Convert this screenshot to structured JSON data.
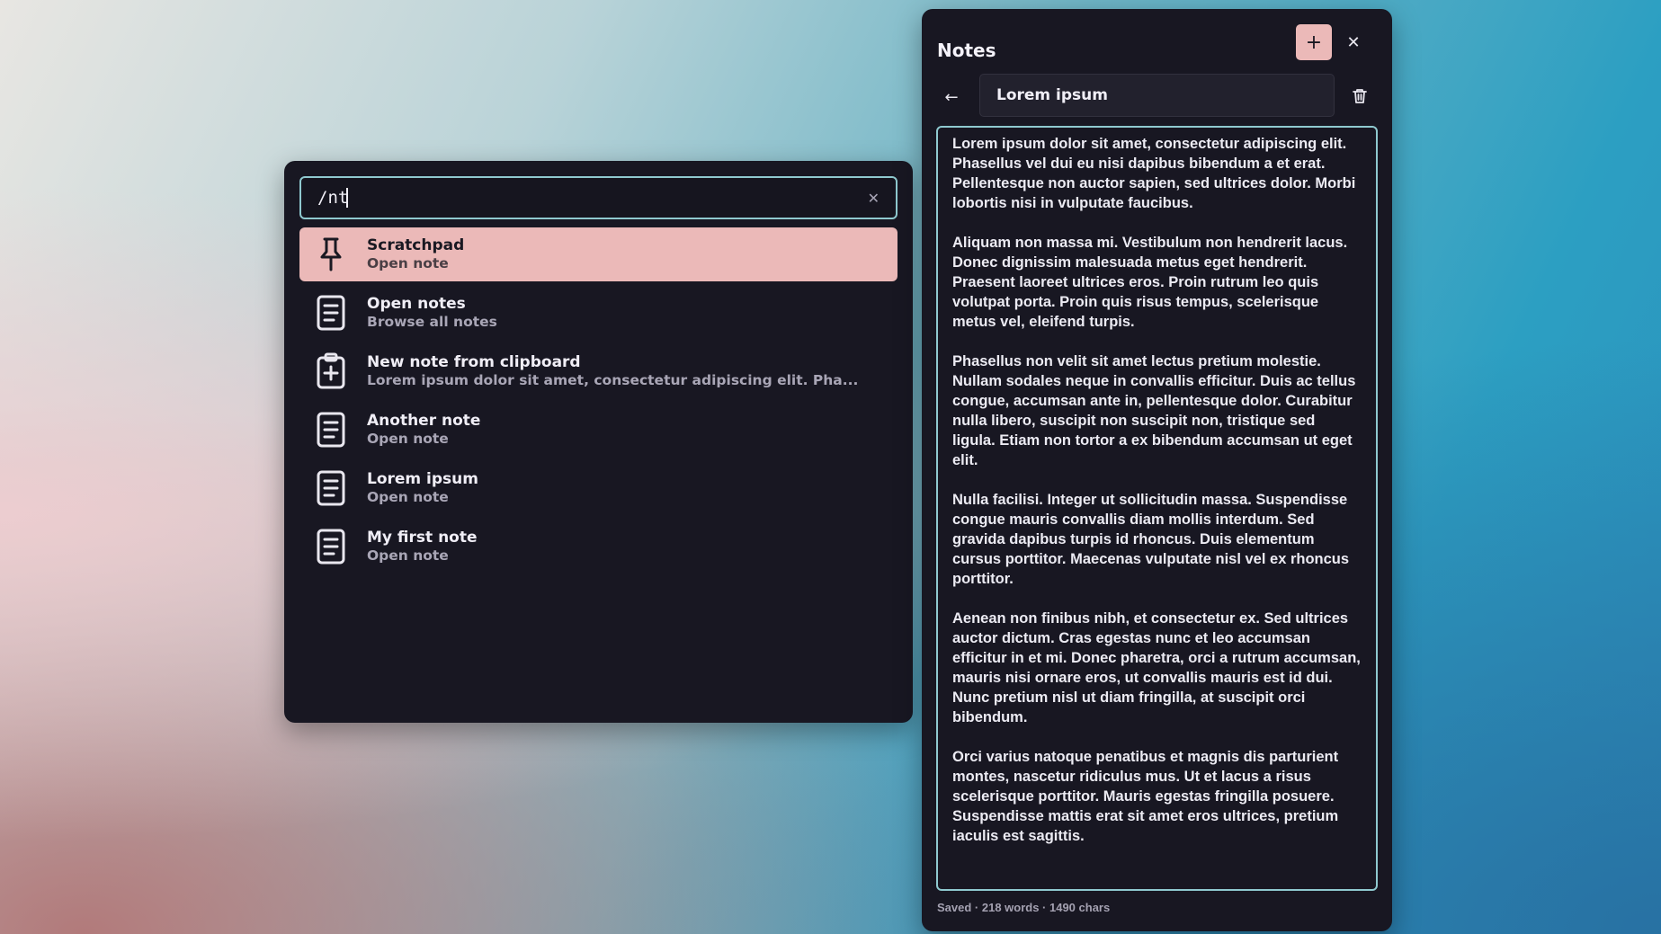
{
  "launcher": {
    "query": "/nt",
    "results": [
      {
        "icon": "pin-icon",
        "title": "Scratchpad",
        "subtitle": "Open note"
      },
      {
        "icon": "note-icon",
        "title": "Open notes",
        "subtitle": "Browse all notes"
      },
      {
        "icon": "clipboard-plus-icon",
        "title": "New note from clipboard",
        "subtitle": "Lorem ipsum dolor sit amet, consectetur adipiscing elit. Pha..."
      },
      {
        "icon": "note-icon",
        "title": "Another note",
        "subtitle": "Open note"
      },
      {
        "icon": "note-icon",
        "title": "Lorem ipsum",
        "subtitle": "Open note"
      },
      {
        "icon": "note-icon",
        "title": "My first note",
        "subtitle": "Open note"
      }
    ]
  },
  "notes": {
    "title": "Notes",
    "note_title": "Lorem ipsum",
    "paragraphs": [
      "Lorem ipsum dolor sit amet, consectetur adipiscing elit. Phasellus vel dui eu nisi dapibus bibendum a et erat. Pellentesque non auctor sapien, sed ultrices dolor. Morbi lobortis nisi in vulputate faucibus.",
      "Aliquam non massa mi. Vestibulum non hendrerit lacus. Donec dignissim malesuada metus eget hendrerit. Praesent laoreet ultrices eros. Proin rutrum leo quis volutpat porta. Proin quis risus tempus, scelerisque metus vel, eleifend turpis.",
      "Phasellus non velit sit amet lectus pretium molestie. Nullam sodales neque in convallis efficitur. Duis ac tellus congue, accumsan ante in, pellentesque dolor. Curabitur nulla libero, suscipit non suscipit non, tristique sed ligula. Etiam non tortor a ex bibendum accumsan ut eget elit.",
      "Nulla facilisi. Integer ut sollicitudin massa. Suspendisse congue mauris convallis diam mollis interdum. Sed gravida dapibus turpis id rhoncus. Duis elementum cursus porttitor. Maecenas vulputate nisl vel ex rhoncus porttitor.",
      "Aenean non finibus nibh, et consectetur ex. Sed ultrices auctor dictum. Cras egestas nunc et leo accumsan efficitur in et mi. Donec pharetra, orci a rutrum accumsan, mauris nisi ornare eros, ut convallis mauris est id dui. Nunc pretium nisl ut diam fringilla, at suscipit orci bibendum.",
      "Orci varius natoque penatibus et magnis dis parturient montes, nascetur ridiculus mus. Ut et lacus a risus scelerisque porttitor. Mauris egestas fringilla posuere. Suspendisse mattis erat sit amet eros ultrices, pretium iaculis est sagittis."
    ],
    "status": "Saved · 218 words · 1490 chars"
  },
  "colors": {
    "accent": "#ebb9b8",
    "focus_border": "#8fc9cf",
    "panel_bg": "#181722"
  }
}
